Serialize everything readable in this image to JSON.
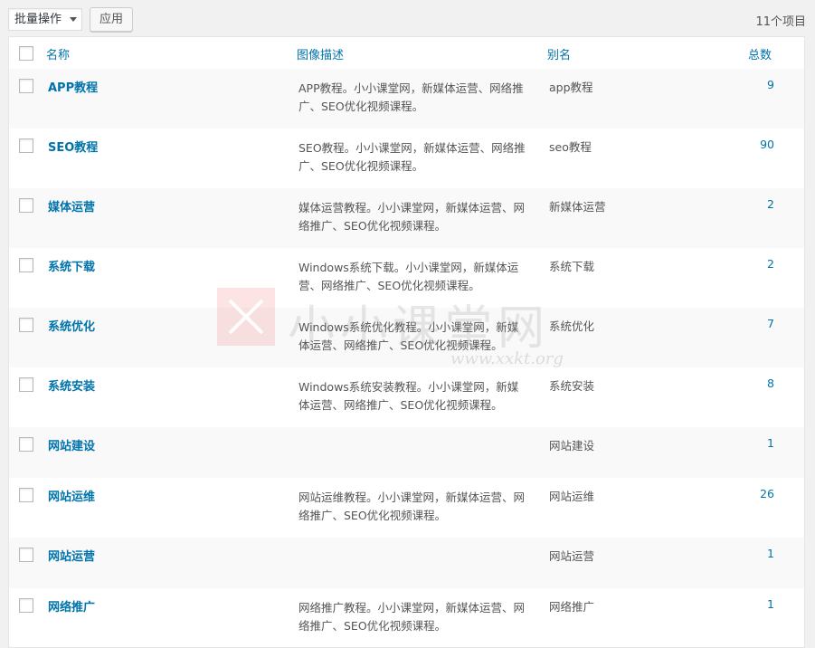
{
  "toolbar": {
    "bulk_action": "批量操作",
    "apply_label": "应用",
    "item_count": "11个项目"
  },
  "columns": {
    "name": "名称",
    "description": "图像描述",
    "slug": "别名",
    "count": "总数"
  },
  "rows": [
    {
      "name": "APP教程",
      "desc": "APP教程。小小课堂网，新媒体运营、网络推广、SEO优化视频课程。",
      "slug": "app教程",
      "count": "9"
    },
    {
      "name": "SEO教程",
      "desc": "SEO教程。小小课堂网，新媒体运营、网络推广、SEO优化视频课程。",
      "slug": "seo教程",
      "count": "90"
    },
    {
      "name": "媒体运营",
      "desc": "媒体运营教程。小小课堂网，新媒体运营、网络推广、SEO优化视频课程。",
      "slug": "新媒体运营",
      "count": "2"
    },
    {
      "name": "系统下载",
      "desc": "Windows系统下载。小小课堂网，新媒体运营、网络推广、SEO优化视频课程。",
      "slug": "系统下载",
      "count": "2"
    },
    {
      "name": "系统优化",
      "desc": "Windows系统优化教程。小小课堂网，新媒体运营、网络推广、SEO优化视频课程。",
      "slug": "系统优化",
      "count": "7"
    },
    {
      "name": "系统安装",
      "desc": "Windows系统安装教程。小小课堂网，新媒体运营、网络推广、SEO优化视频课程。",
      "slug": "系统安装",
      "count": "8"
    },
    {
      "name": "网站建设",
      "desc": "",
      "slug": "网站建设",
      "count": "1"
    },
    {
      "name": "网站运维",
      "desc": "网站运维教程。小小课堂网，新媒体运营、网络推广、SEO优化视频课程。",
      "slug": "网站运维",
      "count": "26"
    },
    {
      "name": "网站运营",
      "desc": "",
      "slug": "网站运营",
      "count": "1"
    },
    {
      "name": "网络推广",
      "desc": "网络推广教程。小小课堂网，新媒体运营、网络推广、SEO优化视频课程。",
      "slug": "网络推广",
      "count": "1"
    }
  ],
  "watermark": {
    "text": "小小课堂网",
    "url": "www.xxkt.org"
  }
}
